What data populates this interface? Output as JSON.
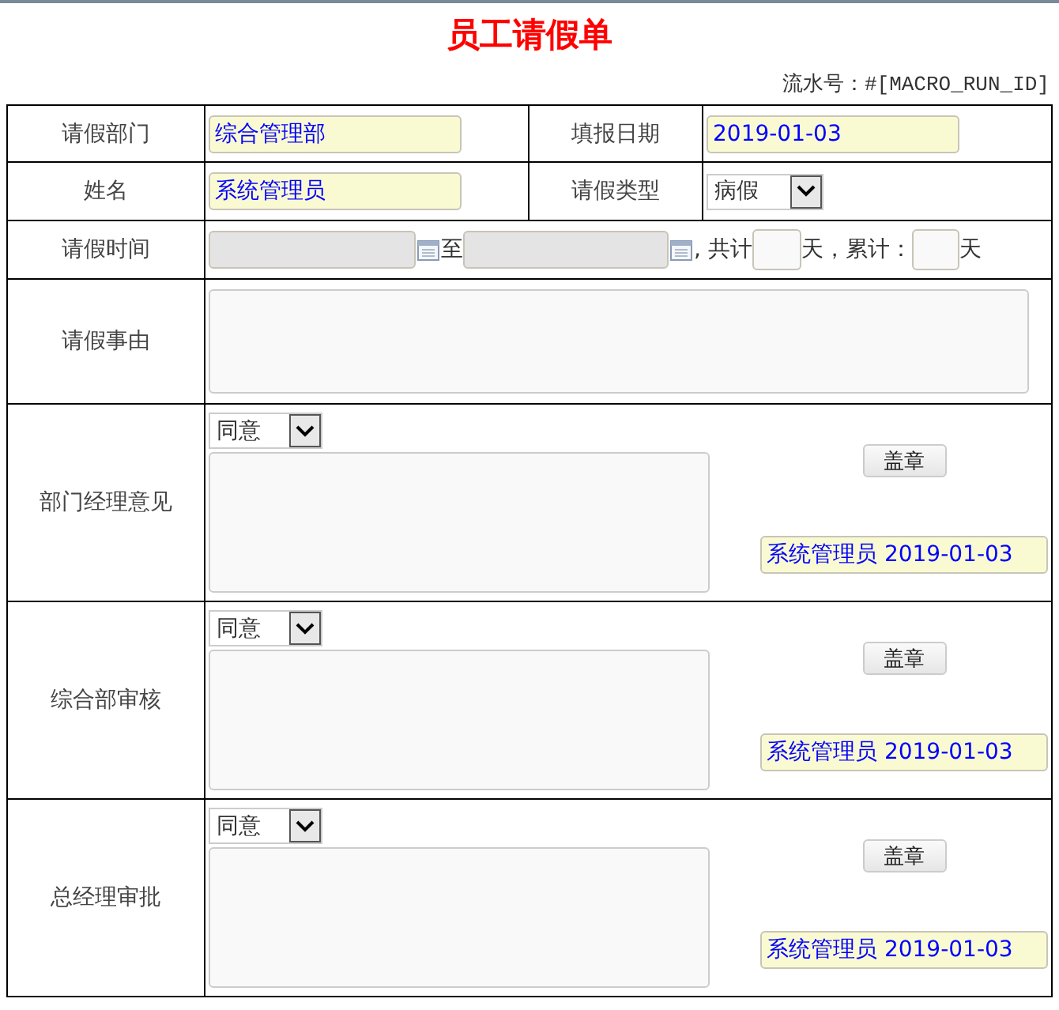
{
  "title": "员工请假单",
  "serial": {
    "label": "流水号：",
    "value": "#[MACRO_RUN_ID]"
  },
  "department": {
    "label": "请假部门",
    "value": "综合管理部"
  },
  "fill_date": {
    "label": "填报日期",
    "value": "2019-01-03"
  },
  "name": {
    "label": "姓名",
    "value": "系统管理员"
  },
  "leave_type": {
    "label": "请假类型",
    "value": "病假"
  },
  "leave_time": {
    "label": "请假时间",
    "to": "至",
    "total_prefix": ", 共计",
    "total_unit": "天，累计：",
    "cumulative_unit": "天"
  },
  "reason": {
    "label": "请假事由"
  },
  "approvals": [
    {
      "label": "部门经理意见",
      "opinion": "同意",
      "seal_button": "盖章",
      "signature": "系统管理员 2019-01-03"
    },
    {
      "label": "综合部审核",
      "opinion": "同意",
      "seal_button": "盖章",
      "signature": "系统管理员 2019-01-03"
    },
    {
      "label": "总经理审批",
      "opinion": "同意",
      "seal_button": "盖章",
      "signature": "系统管理员 2019-01-03"
    }
  ]
}
